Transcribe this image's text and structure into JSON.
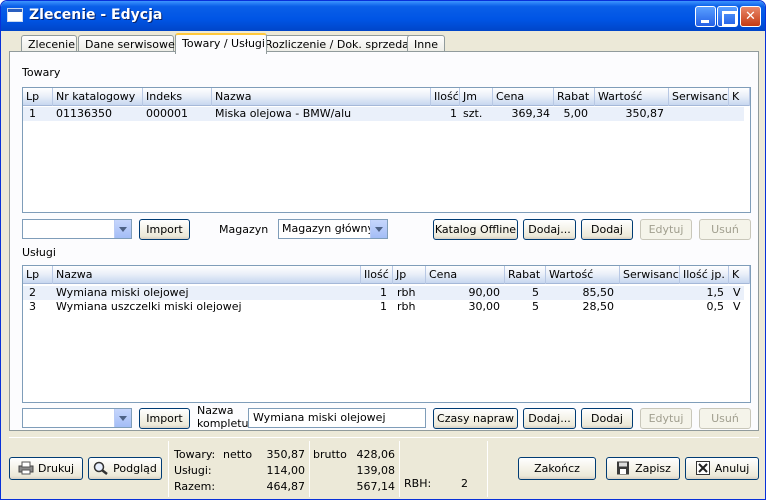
{
  "window": {
    "title": "Zlecenie - Edycja"
  },
  "tabs": [
    "Zlecenie",
    "Dane serwisowe",
    "Towary / Usługi",
    "Rozliczenie / Dok. sprzedaży",
    "Inne"
  ],
  "towary": {
    "label": "Towary",
    "columns": [
      "Lp",
      "Nr katalogowy",
      "Indeks",
      "Nazwa",
      "Ilość",
      "Jm",
      "Cena",
      "Rabat",
      "Wartość",
      "Serwisanci",
      "K"
    ],
    "rows": [
      {
        "lp": "1",
        "nr": "01136350",
        "indeks": "000001",
        "nazwa": "Miska olejowa - BMW/alu",
        "ilosc": "1",
        "jm": "szt.",
        "cena": "369,34",
        "rabat": "5,00",
        "wartosc": "350,87",
        "serwisanci": "",
        "k": ""
      }
    ],
    "import_label": "Import",
    "magazyn_label": "Magazyn",
    "magazyn_value": "Magazyn główny",
    "buttons": [
      "Katalog Offline",
      "Dodaj...",
      "Dodaj",
      "Edytuj",
      "Usuń"
    ]
  },
  "uslugi": {
    "label": "Usługi",
    "columns": [
      "Lp",
      "Nazwa",
      "Ilość",
      "Jp",
      "Cena",
      "Rabat",
      "Wartość",
      "Serwisanci",
      "Ilość jp.",
      "K"
    ],
    "rows": [
      {
        "lp": "2",
        "nazwa": "Wymiana miski olejowej",
        "ilosc": "1",
        "jp": "rbh",
        "cena": "90,00",
        "rabat": "5",
        "wartosc": "85,50",
        "serwisanci": "",
        "ilosc_jp": "1,5",
        "k": "V"
      },
      {
        "lp": "3",
        "nazwa": "Wymiana uszczelki  miski olejowej",
        "ilosc": "1",
        "jp": "rbh",
        "cena": "30,00",
        "rabat": "5",
        "wartosc": "28,50",
        "serwisanci": "",
        "ilosc_jp": "0,5",
        "k": "V"
      }
    ],
    "import_label": "Import",
    "nazwa_kompletu_label": [
      "Nazwa",
      "kompletu:"
    ],
    "nazwa_kompletu_value": "Wymiana miski olejowej",
    "buttons": [
      "Czasy napraw",
      "Dodaj...",
      "Dodaj",
      "Edytuj",
      "Usuń"
    ]
  },
  "footer": {
    "print_label": "Drukuj",
    "preview_label": "Podgląd",
    "summary": {
      "towary_label": "Towary:",
      "netto_label": "netto",
      "brutto_label": "brutto",
      "uslugi_label": "Usługi:",
      "razem_label": "Razem:",
      "towary_netto": "350,87",
      "towary_brutto": "428,06",
      "uslugi_netto": "114,00",
      "uslugi_brutto": "139,08",
      "razem_netto": "464,87",
      "razem_brutto": "567,14",
      "rbh_label": "RBH:",
      "rbh_value": "2"
    },
    "finish_label": "Zakończ",
    "save_label": "Zapisz",
    "cancel_label": "Anuluj"
  }
}
